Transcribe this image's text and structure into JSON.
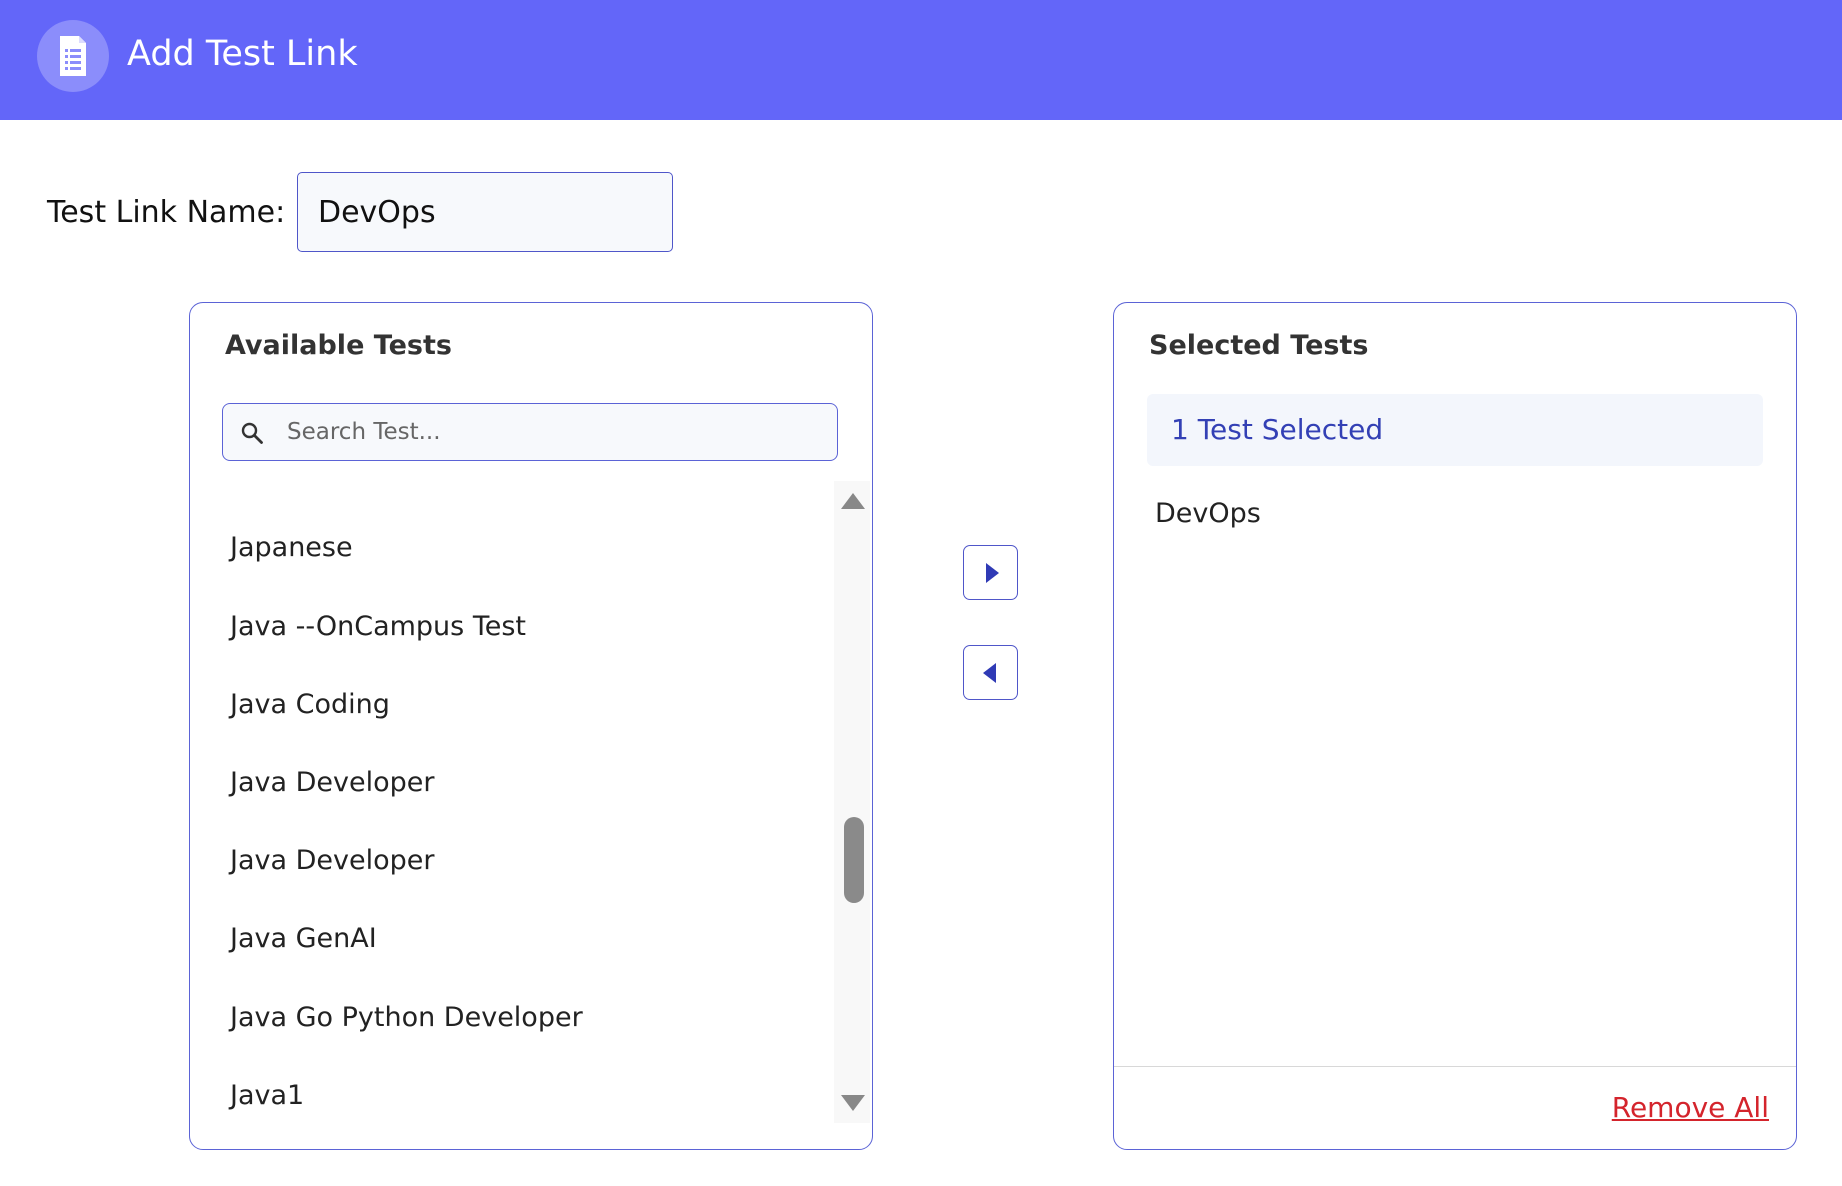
{
  "header": {
    "title": "Add Test Link",
    "icon": "document-list-icon",
    "color": "#6366f9"
  },
  "form": {
    "name_label": "Test Link Name:",
    "name_value": "DevOps"
  },
  "available": {
    "title": "Available Tests",
    "search_placeholder": "Search Test...",
    "items": [
      "Japanese",
      "Java --OnCampus Test",
      "Java Coding",
      "Java Developer",
      "Java Developer",
      "Java GenAI",
      "Java Go Python Developer",
      "Java1"
    ]
  },
  "selected": {
    "title": "Selected Tests",
    "count_label": "1 Test Selected",
    "items": [
      "DevOps"
    ],
    "remove_all_label": "Remove All"
  },
  "colors": {
    "accent": "#6366f9",
    "border": "#5b63d6",
    "link_danger": "#d4242c",
    "selected_text": "#3340b5"
  }
}
